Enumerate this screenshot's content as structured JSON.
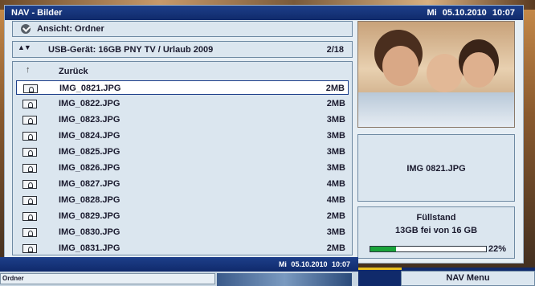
{
  "window": {
    "title": "NAV - Bilder",
    "datetime": "Mi 05.10.2010  10:07"
  },
  "view": {
    "label": "Ansicht: Ordner"
  },
  "usb": {
    "path": "USB-Gerät: 16GB PNY TV / Urlaub 2009",
    "position": "2/18"
  },
  "list": {
    "back_label": "Zurück",
    "selected_index": 0,
    "files": [
      {
        "name": "IMG_0821.JPG",
        "size": "2MB"
      },
      {
        "name": "IMG_0822.JPG",
        "size": "2MB"
      },
      {
        "name": "IMG_0823.JPG",
        "size": "3MB"
      },
      {
        "name": "IMG_0824.JPG",
        "size": "3MB"
      },
      {
        "name": "IMG_0825.JPG",
        "size": "3MB"
      },
      {
        "name": "IMG_0826.JPG",
        "size": "3MB"
      },
      {
        "name": "IMG_0827.JPG",
        "size": "4MB"
      },
      {
        "name": "IMG_0828.JPG",
        "size": "4MB"
      },
      {
        "name": "IMG_0829.JPG",
        "size": "2MB"
      },
      {
        "name": "IMG_0830.JPG",
        "size": "3MB"
      },
      {
        "name": "IMG_0831.JPG",
        "size": "2MB"
      }
    ]
  },
  "preview": {
    "filename": "IMG 0821.JPG"
  },
  "storage": {
    "label": "Füllstand",
    "detail": "13GB fei von 16 GB",
    "percent_label": "22%",
    "percent": 22
  },
  "background_window": {
    "datetime": "Mi 05.10.2010  10:07",
    "view_label": "Ordner"
  },
  "nav_menu": {
    "label": "NAV Menu"
  },
  "colors": {
    "title_bar": "#102a6b",
    "panel": "#dbe6ef",
    "selection_border": "#1d3f8a",
    "progress_fill": "#1aa33a",
    "accent": "#e8c020"
  }
}
